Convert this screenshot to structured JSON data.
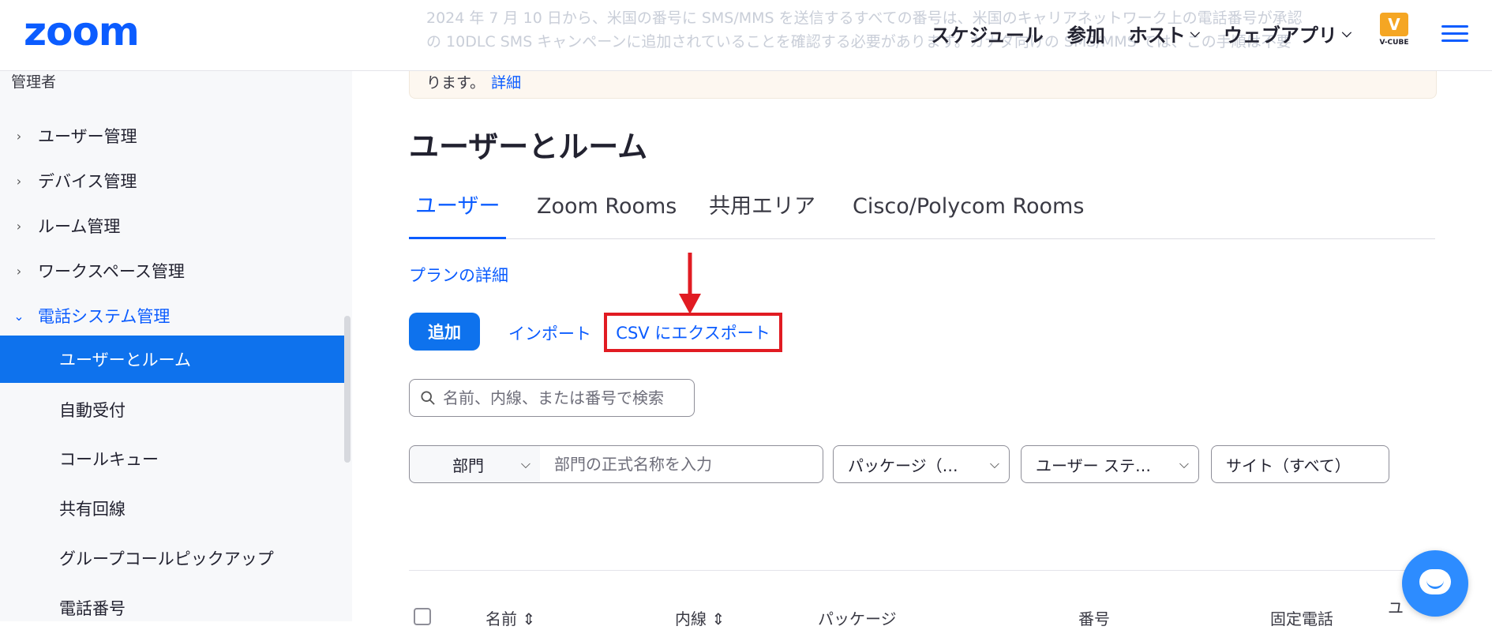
{
  "header": {
    "logo": "zoom",
    "banner_line1": "2024 年 7 月 10 日から、米国の番号に SMS/MMS を送信するすべての番号は、米国のキャリアネットワーク上の電話番号が承認",
    "banner_line2": "の 10DLC SMS キャンペーンに追加されていることを確認する必要があります。カナダ向けの SMS/MMS では、この手順は不要",
    "banner_line3": "ります。",
    "banner_link": "詳細",
    "nav": [
      {
        "label": "スケジュール"
      },
      {
        "label": "参加"
      },
      {
        "label": "ホスト",
        "chev": "⌵"
      },
      {
        "label": "ウェブアプリ",
        "chev": "⌵"
      }
    ],
    "brand_caption": "V-CUBE",
    "brand_mark": "V"
  },
  "sidebar": {
    "admin_label": "管理者",
    "items": [
      {
        "label": "ユーザー管理",
        "arrow": "›"
      },
      {
        "label": "デバイス管理",
        "arrow": "›"
      },
      {
        "label": "ルーム管理",
        "arrow": "›"
      },
      {
        "label": "ワークスペース管理",
        "arrow": "›"
      },
      {
        "label": "電話システム管理",
        "arrow": "⌄"
      }
    ],
    "subitems": [
      {
        "label": "ユーザーとルーム"
      },
      {
        "label": "自動受付"
      },
      {
        "label": "コールキュー"
      },
      {
        "label": "共有回線"
      },
      {
        "label": "グループコールピックアップ"
      },
      {
        "label": "電話番号"
      }
    ]
  },
  "main": {
    "title": "ユーザーとルーム",
    "tabs": [
      {
        "label": "ユーザー"
      },
      {
        "label": "Zoom Rooms"
      },
      {
        "label": "共用エリア"
      },
      {
        "label": "Cisco/Polycom Rooms"
      }
    ],
    "plan_link": "プランの詳細",
    "add_button": "追加",
    "import_button": "インポート",
    "export_button": "CSV にエクスポート",
    "search_placeholder": "名前、内線、または番号で検索",
    "filters": {
      "dept_select": "部門",
      "dept_placeholder": "部門の正式名称を入力",
      "package": "パッケージ（…",
      "user_status": "ユーザー ステ…",
      "site": "サイト（すべて）"
    },
    "table_headers": {
      "name": "名前 ⇕",
      "ext": "内線 ⇕",
      "package": "パッケージ",
      "number": "番号",
      "landline": "固定電話",
      "edge": "ユ"
    }
  },
  "colors": {
    "brand": "#0b5cff",
    "sidebar_active": "#0e72ed",
    "highlight": "#e11b22"
  }
}
